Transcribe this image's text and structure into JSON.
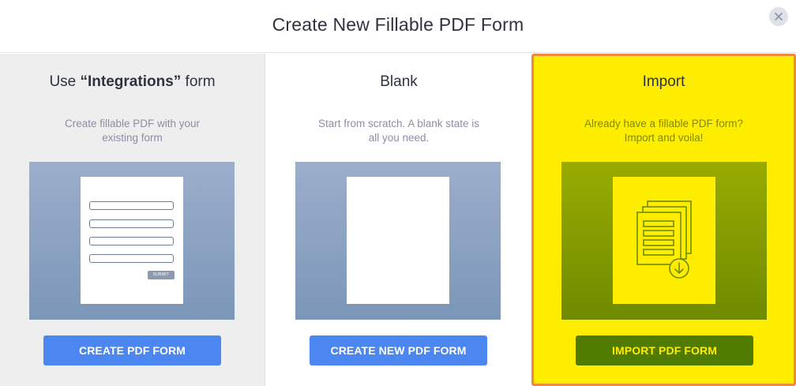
{
  "modal": {
    "title": "Create New Fillable PDF Form",
    "close_icon": "close-icon"
  },
  "panels": {
    "integrations": {
      "title_prefix": "Use ",
      "title_bold": "“Integrations”",
      "title_suffix": " form",
      "description": "Create fillable PDF with your existing form",
      "preview_submit": "SUBMIT",
      "button": "CREATE PDF FORM"
    },
    "blank": {
      "title": "Blank",
      "description": "Start from scratch. A blank state is all you need.",
      "button": "CREATE NEW PDF FORM"
    },
    "import": {
      "title": "Import",
      "description": "Already have a fillable PDF form? Import and voila!",
      "preview_icon": "pdf-import-icon",
      "button": "IMPORT PDF FORM",
      "selected": true
    }
  },
  "colors": {
    "primary_button": "#4b86f1",
    "import_highlight": "#ffed00",
    "import_border": "#ee8a3d",
    "import_button": "#4f7c00"
  }
}
